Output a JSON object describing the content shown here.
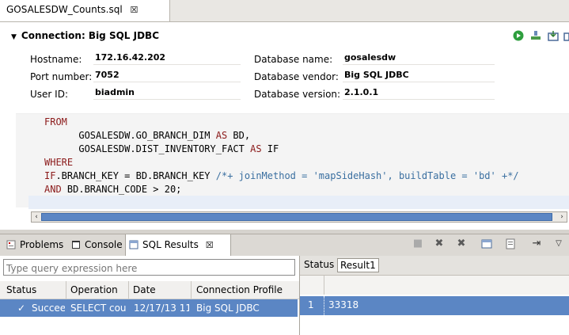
{
  "editor_tab": {
    "filename": "GOSALESDW_Counts.sql",
    "close_glyph": "☒"
  },
  "connection": {
    "header_label": "Connection: Big SQL JDBC",
    "fields": {
      "hostname_label": "Hostname:",
      "hostname": "172.16.42.202",
      "port_label": "Port number:",
      "port": "7052",
      "userid_label": "User ID:",
      "userid": "biadmin",
      "dbname_label": "Database name:",
      "dbname": "gosalesdw",
      "dbvendor_label": "Database vendor:",
      "dbvendor": "Big SQL JDBC",
      "dbversion_label": "Database version:",
      "dbversion": "2.1.0.1"
    }
  },
  "sql": {
    "l1_kw": "FROM",
    "l2_pre": "      GOSALESDW.GO_BRANCH_DIM ",
    "l2_kw": "AS",
    "l2_post": " BD,",
    "l3_pre": "      GOSALESDW.DIST_INVENTORY_FACT ",
    "l3_kw": "AS",
    "l3_post": " IF",
    "l4_kw": "WHERE",
    "l5_kw": "IF",
    "l5_mid": ".BRANCH_KEY = BD.BRANCH_KEY ",
    "l5_comment": "/*+ joinMethod = 'mapSideHash', buildTable = 'bd' +*/",
    "l6_kw": "AND",
    "l6_post": " BD.BRANCH_CODE > 20;"
  },
  "views": {
    "problems": "Problems",
    "console": "Console",
    "sql_results": "SQL Results",
    "close_glyph": "☒"
  },
  "history": {
    "filter_placeholder": "Type query expression here",
    "columns": [
      "Status",
      "Operation",
      "Date",
      "Connection Profile"
    ],
    "rows": [
      {
        "status": "Succee",
        "operation": "SELECT cou",
        "date": "12/17/13 11:",
        "profile": "Big SQL JDBC"
      }
    ]
  },
  "results": {
    "tabs": [
      "Status",
      "Result1"
    ],
    "rows": [
      {
        "index": "1",
        "value": "33318"
      }
    ]
  },
  "colors": {
    "selection": "#5b86c4",
    "keyword": "#8b1a1a",
    "comment": "#3a6fa0"
  }
}
